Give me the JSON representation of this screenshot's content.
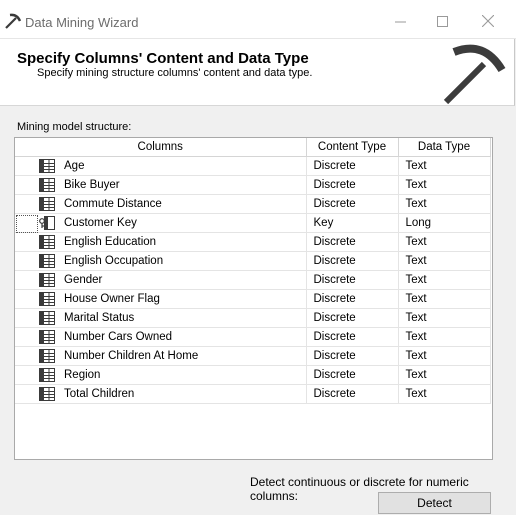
{
  "window": {
    "title": "Data Mining Wizard",
    "minimize": "—",
    "maximize": "☐",
    "close": "✕"
  },
  "header": {
    "title": "Specify Columns' Content and Data Type",
    "subtitle": "Specify mining structure columns' content and data type."
  },
  "section_label": "Mining model structure:",
  "grid": {
    "headers": [
      "Columns",
      "Content Type",
      "Data Type"
    ],
    "rows": [
      {
        "name": "Age",
        "content": "Discrete",
        "type": "Text",
        "icon": "column-icon"
      },
      {
        "name": "Bike Buyer",
        "content": "Discrete",
        "type": "Text",
        "icon": "column-icon"
      },
      {
        "name": "Commute Distance",
        "content": "Discrete",
        "type": "Text",
        "icon": "column-icon"
      },
      {
        "name": "Customer Key",
        "content": "Key",
        "type": "Long",
        "icon": "key-column-icon"
      },
      {
        "name": "English Education",
        "content": "Discrete",
        "type": "Text",
        "icon": "column-icon"
      },
      {
        "name": "English Occupation",
        "content": "Discrete",
        "type": "Text",
        "icon": "column-icon"
      },
      {
        "name": "Gender",
        "content": "Discrete",
        "type": "Text",
        "icon": "column-icon"
      },
      {
        "name": "House Owner Flag",
        "content": "Discrete",
        "type": "Text",
        "icon": "column-icon"
      },
      {
        "name": "Marital Status",
        "content": "Discrete",
        "type": "Text",
        "icon": "column-icon"
      },
      {
        "name": "Number Cars Owned",
        "content": "Discrete",
        "type": "Text",
        "icon": "column-icon"
      },
      {
        "name": "Number Children At Home",
        "content": "Discrete",
        "type": "Text",
        "icon": "column-icon"
      },
      {
        "name": "Region",
        "content": "Discrete",
        "type": "Text",
        "icon": "column-icon"
      },
      {
        "name": "Total Children",
        "content": "Discrete",
        "type": "Text",
        "icon": "column-icon"
      }
    ]
  },
  "footer": {
    "detect_label": "Detect continuous or discrete for numeric columns:",
    "detect_button": "Detect"
  }
}
